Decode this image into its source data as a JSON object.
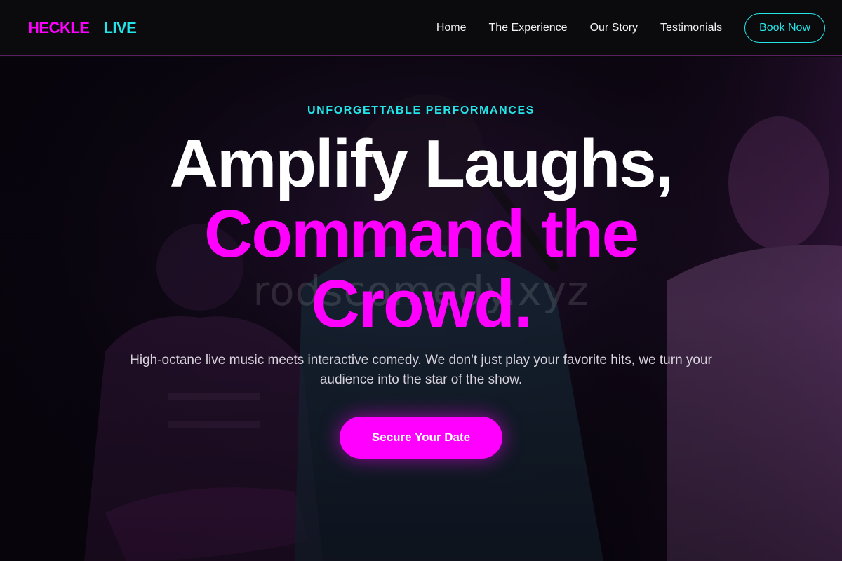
{
  "brand": {
    "logo_part1": "HECKLE",
    "logo_part2": "LIVE"
  },
  "nav": {
    "links": [
      "Home",
      "The Experience",
      "Our Story",
      "Testimonials"
    ],
    "cta_label": "Book Now"
  },
  "hero": {
    "eyebrow": "UNFORGETTABLE PERFORMANCES",
    "headline_line1": "Amplify Laughs,",
    "headline_line2": "Command the",
    "headline_line3": "Crowd.",
    "subtitle": "High-octane live music meets interactive comedy. We don't just play your favorite hits, we turn your audience into the star of the show.",
    "cta_label": "Secure Your Date",
    "watermark": "rodscomedy.xyz"
  },
  "colors": {
    "magenta": "#ff00ff",
    "cyan": "#22e6ea",
    "background": "#0b0b0d"
  }
}
